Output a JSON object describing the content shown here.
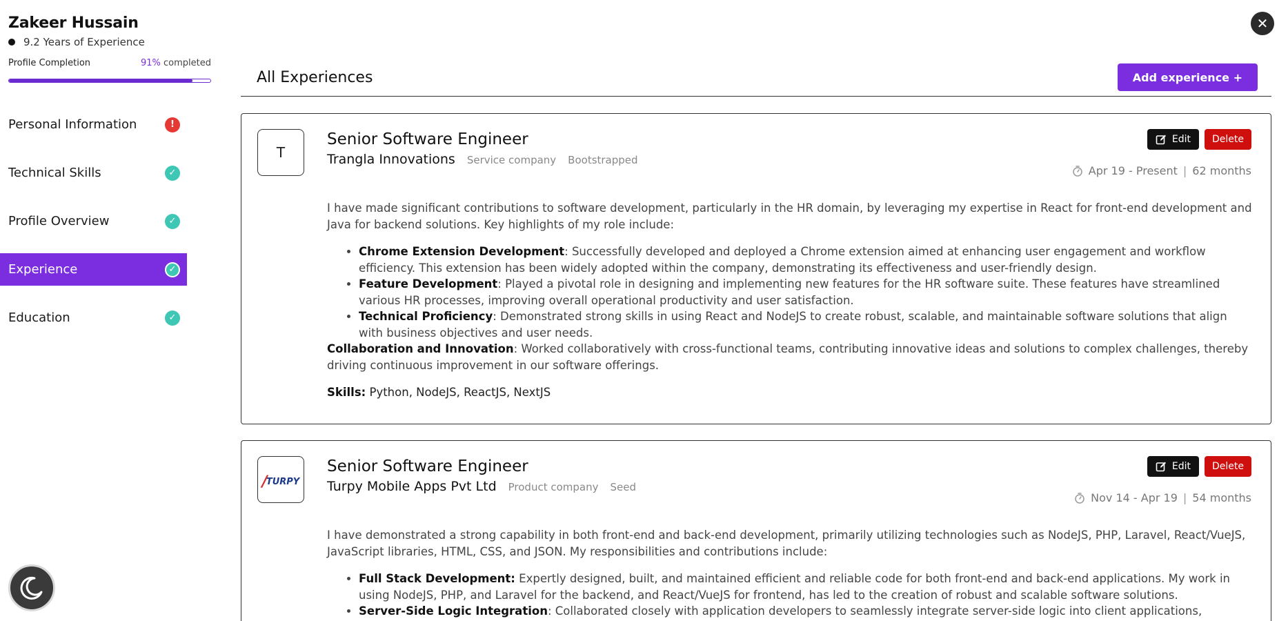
{
  "profile": {
    "name": "Zakeer Hussain",
    "experience_years": "9.2 Years of Experience",
    "completion_label": "Profile Completion",
    "completion_pct": "91%",
    "completion_suffix": " completed",
    "completion_value": 0.91
  },
  "nav": {
    "items": [
      {
        "label": "Personal Information",
        "status": "warning"
      },
      {
        "label": "Technical Skills",
        "status": "complete"
      },
      {
        "label": "Profile Overview",
        "status": "complete"
      },
      {
        "label": "Experience",
        "status": "complete",
        "active": true
      },
      {
        "label": "Education",
        "status": "complete"
      }
    ]
  },
  "header": {
    "title": "All Experiences",
    "add_button": "Add experience +"
  },
  "experiences": [
    {
      "logo_letter": "T",
      "role": "Senior Software Engineer",
      "company": "Trangla Innovations",
      "company_type": "Service company",
      "funding": "Bootstrapped",
      "period": "Apr 19 - Present",
      "duration": "62 months",
      "edit_label": "Edit",
      "delete_label": "Delete",
      "intro": "I have made significant contributions to software development, particularly in the HR domain, by leveraging my expertise in React for front-end development and Java for backend solutions. Key highlights of my role include:",
      "bullets": [
        {
          "title": "Chrome Extension Development",
          "text": ": Successfully developed and deployed a Chrome extension aimed at enhancing user engagement and workflow efficiency. This extension has been widely adopted within the company, demonstrating its effectiveness and user-friendly design."
        },
        {
          "title": "Feature Development",
          "text": ": Played a pivotal role in designing and implementing new features for the HR software suite. These features have streamlined various HR processes, improving overall operational productivity and user satisfaction."
        },
        {
          "title": "Technical Proficiency",
          "text": ": Demonstrated strong skills in using React and NodeJS to create robust, scalable, and maintainable software solutions that align with business objectives and user needs."
        }
      ],
      "after_title": "Collaboration and Innovation",
      "after_text": ": Worked collaboratively with cross-functional teams, contributing innovative ideas and solutions to complex challenges, thereby driving continuous improvement in our software offerings.",
      "skills_label": "Skills:",
      "skills": " Python, NodeJS, ReactJS, NextJS"
    },
    {
      "logo_text": "TURPY",
      "role": "Senior Software Engineer",
      "company": "Turpy Mobile Apps Pvt Ltd",
      "company_type": "Product company",
      "funding": "Seed",
      "period": "Nov 14 - Apr 19",
      "duration": "54 months",
      "edit_label": "Edit",
      "delete_label": "Delete",
      "intro": "I have demonstrated a strong capability in both front-end and back-end development, primarily utilizing technologies such as NodeJS, PHP, Laravel, React/VueJS, JavaScript libraries, HTML, CSS, and JSON. My responsibilities and contributions include:",
      "bullets": [
        {
          "title": "Full Stack Development:",
          "text": " Expertly designed, built, and maintained efficient and reliable code for both front-end and back-end applications. My work in using NodeJS, PHP, and Laravel for the backend, and React/VueJS for frontend, has led to the creation of robust and scalable software solutions."
        },
        {
          "title": "Server-Side Logic Integration",
          "text": ": Collaborated closely with application developers to seamlessly integrate server-side logic into client applications, enhancing"
        }
      ]
    }
  ],
  "colors": {
    "accent": "#7b2ee0",
    "complete": "#3ec7b4",
    "warning": "#e53935",
    "delete": "#cf0e0e"
  },
  "icons": {
    "close": "close-icon",
    "theme": "moon-icon",
    "edit": "edit-icon",
    "duration": "timer-icon"
  }
}
